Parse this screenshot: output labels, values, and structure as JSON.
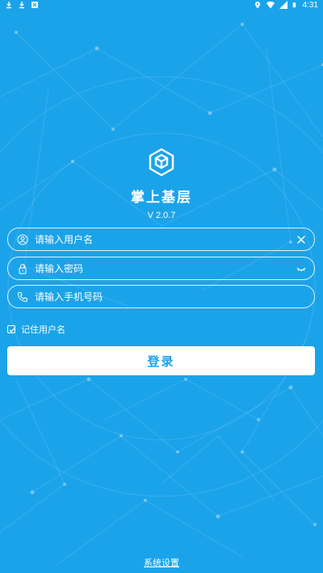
{
  "status_bar": {
    "time": "4:31",
    "left_icons": [
      "download-icon",
      "download-icon",
      "notification-icon"
    ],
    "right_icons": [
      "location-icon",
      "wifi-icon",
      "signal-icon",
      "battery-icon"
    ]
  },
  "app": {
    "title": "掌上基层",
    "version": "V 2.0.7"
  },
  "form": {
    "username": {
      "placeholder": "请输入用户名",
      "value": "",
      "icon": "user-icon",
      "action_icon": "clear-icon"
    },
    "password": {
      "placeholder": "请输入密码",
      "value": "",
      "icon": "lock-icon",
      "action_icon": "eye-closed-icon"
    },
    "phone": {
      "placeholder": "请输入手机号码",
      "value": "",
      "icon": "phone-icon"
    },
    "remember": {
      "label": "记住用户名",
      "checked": true
    },
    "login_label": "登录"
  },
  "footer": {
    "settings_label": "系统设置"
  },
  "colors": {
    "background": "#1ba3ea",
    "button_text": "#1ba3ea",
    "foreground": "#ffffff"
  }
}
